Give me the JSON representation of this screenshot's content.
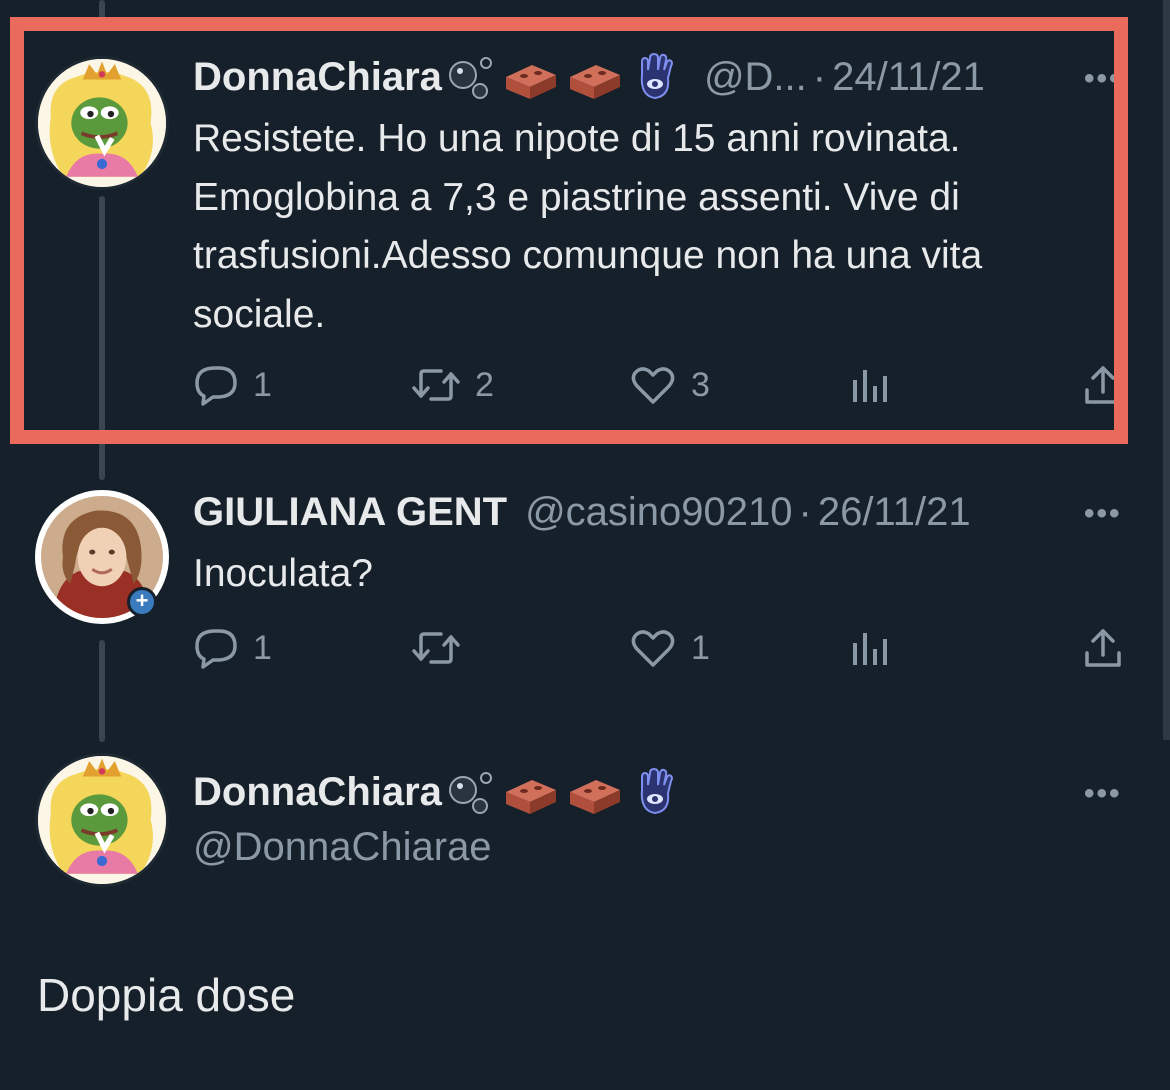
{
  "tweets": [
    {
      "display_name": "DonnaChiara",
      "handle": "@D...",
      "date": "24/11/21",
      "text": "Resistete. Ho una nipote di 15 anni rovinata. Emoglobina a 7,3 e piastrine assenti. Vive di trasfusioni.Adesso comunque non ha una vita sociale.",
      "actions": {
        "replies": "1",
        "retweets": "2",
        "likes": "3"
      },
      "emojis": [
        "bubbles-icon",
        "brick-icon",
        "brick-icon",
        "hamsa-icon"
      ]
    },
    {
      "display_name": "GIULIANA GENT",
      "handle": "@casino90210",
      "date": "26/11/21",
      "text": "Inoculata?",
      "actions": {
        "replies": "1",
        "retweets": "",
        "likes": "1"
      }
    },
    {
      "display_name": "DonnaChiara",
      "handle": "@DonnaChiarae",
      "text": "Doppia dose",
      "emojis": [
        "bubbles-icon",
        "brick-icon",
        "brick-icon",
        "hamsa-icon"
      ]
    }
  ],
  "ui": {
    "separator": "·",
    "more": "•••",
    "highlight_color": "#ea6a5c",
    "background_color": "#16202b"
  }
}
